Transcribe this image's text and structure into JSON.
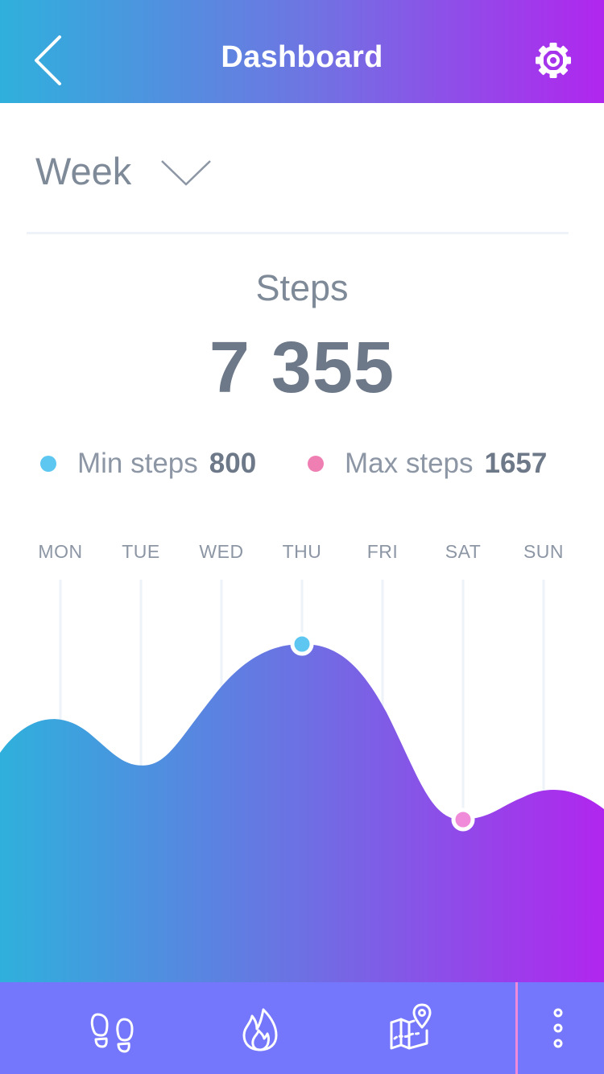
{
  "header": {
    "title": "Dashboard",
    "back_icon": "chevron-left-icon",
    "settings_icon": "gear-icon",
    "gradient": [
      "#2fb0dc",
      "#6d76e2",
      "#b126ee"
    ]
  },
  "period_selector": {
    "value": "Week",
    "icon": "chevron-down-icon"
  },
  "summary": {
    "label": "Steps",
    "value": "7 355"
  },
  "legend": {
    "min": {
      "label": "Min steps",
      "value": "800",
      "color": "#5ec7f1"
    },
    "max": {
      "label": "Max steps",
      "value": "1657",
      "color": "#ef7fb3"
    }
  },
  "chart_data": {
    "type": "area",
    "categories": [
      "MON",
      "TUE",
      "WED",
      "THU",
      "FRI",
      "SAT",
      "SUN"
    ],
    "grid": "vertical",
    "colors": [
      "#2fb0dc",
      "#b126ee"
    ],
    "highlight_markers": [
      {
        "category": "THU",
        "color": "#5ec7f1"
      },
      {
        "category": "SAT",
        "color": "#ef8bd8"
      }
    ]
  },
  "bottom_nav": {
    "items": [
      {
        "name": "steps",
        "icon": "footprints-icon"
      },
      {
        "name": "calories",
        "icon": "flame-icon"
      },
      {
        "name": "map",
        "icon": "map-pin-icon"
      }
    ],
    "more_icon": "vertical-dots-icon",
    "separator_color": "#ef8bd8",
    "background": "#7476fb"
  }
}
